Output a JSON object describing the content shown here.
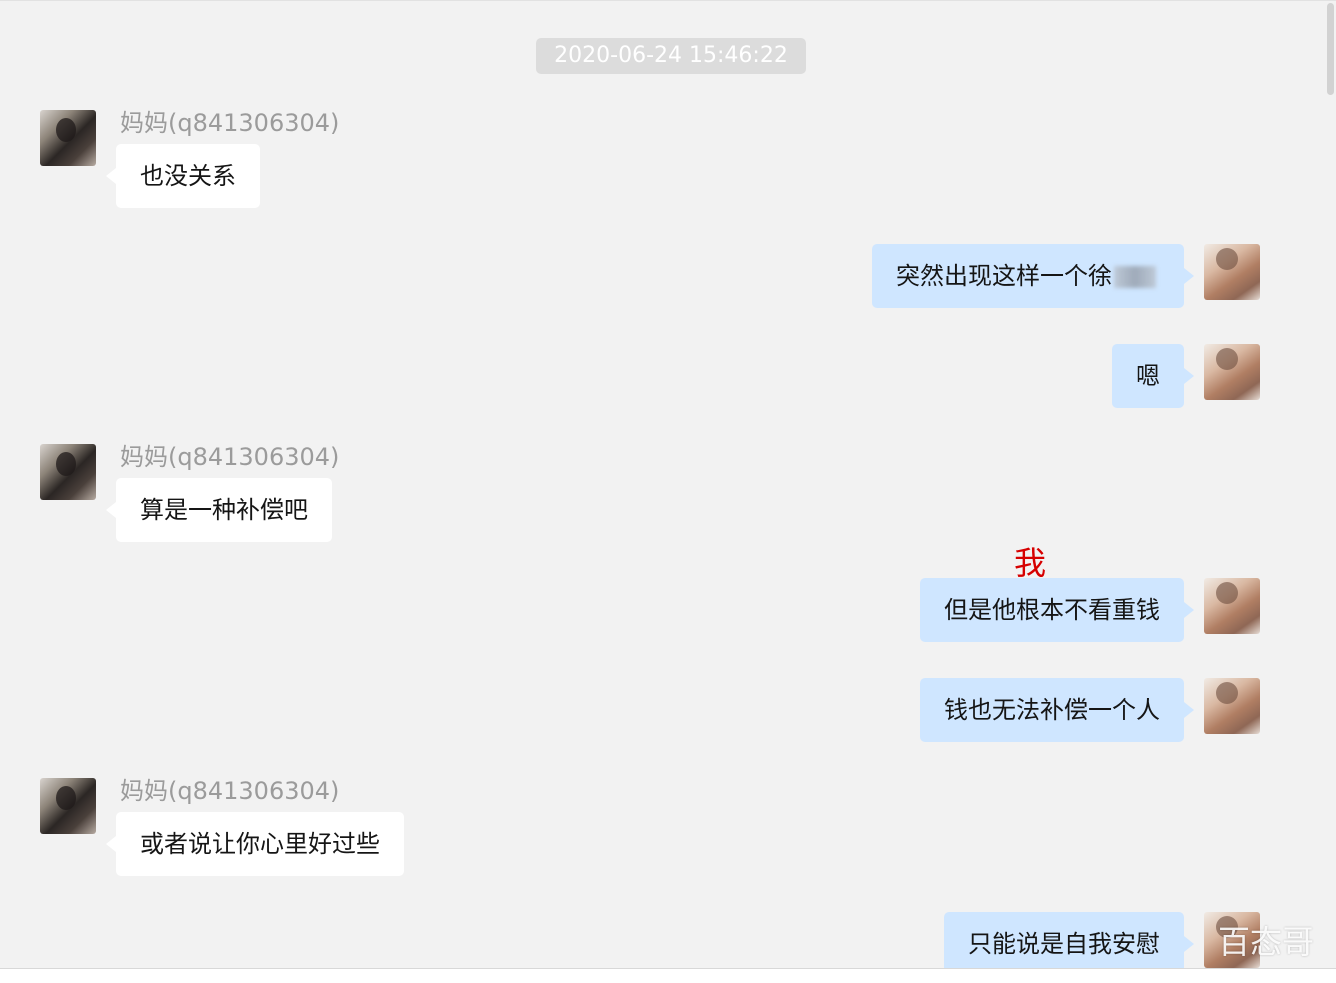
{
  "timestamp": "2020-06-24 15:46:22",
  "contact": {
    "name": "妈妈(q841306304)",
    "avatar_icon": "mom-avatar-icon"
  },
  "self": {
    "avatar_icon": "my-avatar-icon"
  },
  "messages": [
    {
      "sender": "contact",
      "text": "也没关系"
    },
    {
      "sender": "me",
      "text": "突然出现这样一个徐",
      "redacted": true
    },
    {
      "sender": "me",
      "text": "嗯"
    },
    {
      "sender": "contact",
      "text": "算是一种补偿吧"
    },
    {
      "sender": "me",
      "text": "但是他根本不看重钱"
    },
    {
      "sender": "me",
      "text": "钱也无法补偿一个人"
    },
    {
      "sender": "contact",
      "text": "或者说让你心里好过些"
    },
    {
      "sender": "me",
      "text": "只能说是自我安慰"
    }
  ],
  "annotation": "我",
  "watermark": "百态哥",
  "colors": {
    "incoming_bubble": "#ffffff",
    "outgoing_bubble": "#cfe6ff",
    "annotation": "#d60000",
    "background": "#f2f2f2"
  }
}
